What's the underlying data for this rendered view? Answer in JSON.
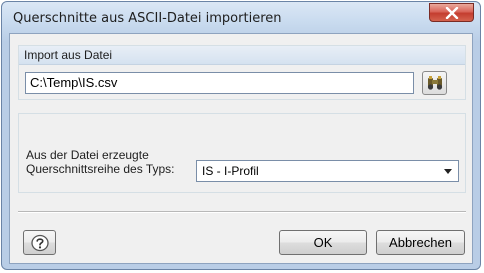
{
  "window": {
    "title": "Querschnitte aus ASCII-Datei importieren",
    "close_icon": "close-x-icon"
  },
  "import_group": {
    "header": "Import aus Datei",
    "file_path": "C:\\Temp\\IS.csv",
    "browse_icon": "binoculars-icon"
  },
  "type_group": {
    "label": "Aus der Datei erzeugte\nQuerschnittsreihe des Typs:",
    "selected": "IS - I-Profil"
  },
  "buttons": {
    "help_icon": "help-icon",
    "ok": "OK",
    "cancel": "Abbrechen"
  }
}
